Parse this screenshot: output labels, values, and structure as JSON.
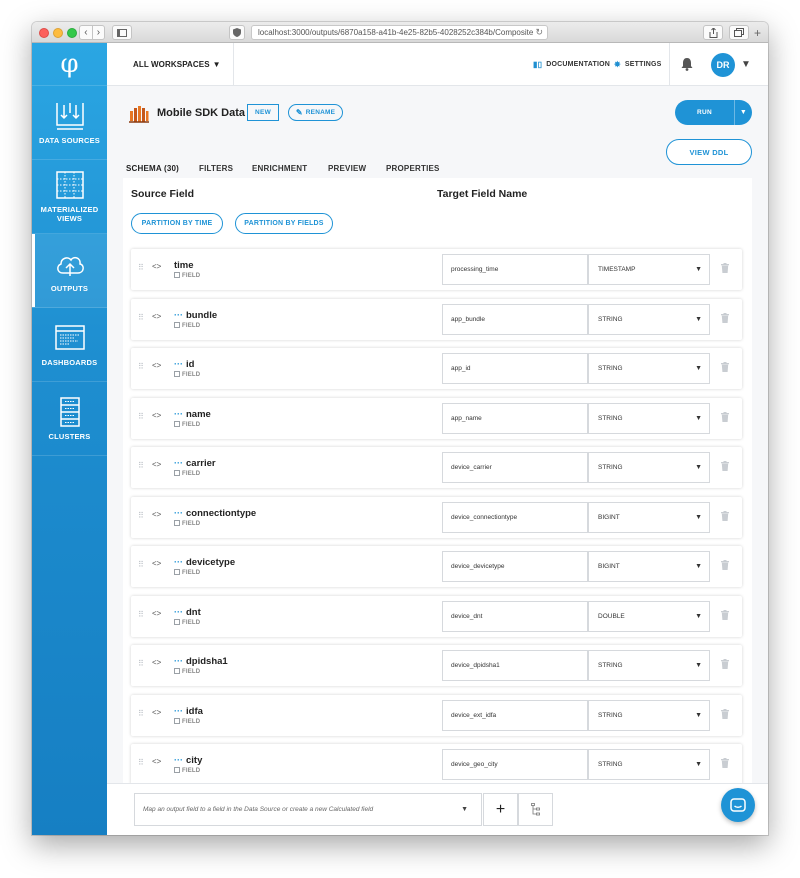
{
  "browser": {
    "url": "localhost:3000/outputs/6870a158-a41b-4e25-82b5-4028252c384b/Composite",
    "nav_back": "‹",
    "nav_forward": "›",
    "new_tab": "+"
  },
  "sidebar": {
    "items": [
      {
        "label": "DATA SOURCES",
        "icon": "data-sources-icon"
      },
      {
        "label": "MATERIALIZED VIEWS",
        "icon": "materialized-views-icon"
      },
      {
        "label": "OUTPUTS",
        "icon": "cloud-upload-icon",
        "active": true
      },
      {
        "label": "DASHBOARDS",
        "icon": "dashboard-icon"
      },
      {
        "label": "CLUSTERS",
        "icon": "server-icon"
      }
    ]
  },
  "header": {
    "workspace": "ALL WORKSPACES",
    "documentation": "DOCUMENTATION",
    "settings": "SETTINGS",
    "avatar_initials": "DR"
  },
  "page": {
    "title": "Mobile SDK Data",
    "badge": "NEW",
    "rename": "RENAME",
    "run": "RUN",
    "view_ddl": "VIEW DDL",
    "tabs": [
      "SCHEMA (30)",
      "FILTERS",
      "ENRICHMENT",
      "PREVIEW",
      "PROPERTIES"
    ]
  },
  "schema": {
    "source_header": "Source Field",
    "target_header": "Target Field Name",
    "partition_time": "PARTITION BY TIME",
    "partition_fields": "PARTITION BY FIELDS",
    "field_type_label": "FIELD",
    "rows": [
      {
        "source": "time",
        "nested": false,
        "target": "processing_time",
        "type": "TIMESTAMP"
      },
      {
        "source": "bundle",
        "nested": true,
        "target": "app_bundle",
        "type": "STRING"
      },
      {
        "source": "id",
        "nested": true,
        "target": "app_id",
        "type": "STRING"
      },
      {
        "source": "name",
        "nested": true,
        "target": "app_name",
        "type": "STRING"
      },
      {
        "source": "carrier",
        "nested": true,
        "target": "device_carrier",
        "type": "STRING"
      },
      {
        "source": "connectiontype",
        "nested": true,
        "target": "device_connectiontype",
        "type": "BIGINT"
      },
      {
        "source": "devicetype",
        "nested": true,
        "target": "device_devicetype",
        "type": "BIGINT"
      },
      {
        "source": "dnt",
        "nested": true,
        "target": "device_dnt",
        "type": "DOUBLE"
      },
      {
        "source": "dpidsha1",
        "nested": true,
        "target": "device_dpidsha1",
        "type": "STRING"
      },
      {
        "source": "idfa",
        "nested": true,
        "target": "device_ext_idfa",
        "type": "STRING"
      },
      {
        "source": "city",
        "nested": true,
        "target": "device_geo_city",
        "type": "STRING"
      }
    ]
  },
  "bottom": {
    "map_placeholder": "Map an output field to a field in the Data Source or create a new Calculated field",
    "add": "+"
  },
  "colors": {
    "accent": "#1f93d6",
    "sidebar_top": "#2ba6e3",
    "sidebar_bottom": "#167fc3"
  }
}
